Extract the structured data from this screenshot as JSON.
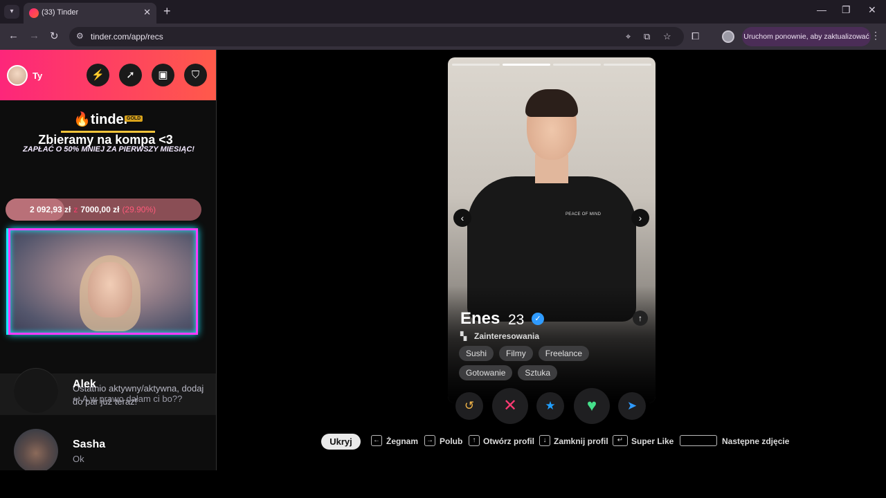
{
  "browser": {
    "tab_title": "(33) Tinder",
    "url": "tinder.com/app/recs",
    "update_label": "Uruchom ponownie, aby zaktualizować"
  },
  "sidebar": {
    "me_label": "Ty",
    "header_buttons": [
      "lightning-icon",
      "explore-icon",
      "briefcase-icon",
      "shield-icon"
    ],
    "promo": {
      "logo": "tinder",
      "badge": "GOLD",
      "title": "Zbieramy na kompa <3",
      "subtitle": "ZAPŁAĆ O 50% MNIEJ ZA PIERWSZY MIESIĄC!",
      "raised": "2 092,93 zł",
      "connector": "z",
      "goal": "7000,00 zł",
      "percent_text": "(29.90%)",
      "progress_fraction": 0.299
    },
    "match_card_text": "Ostatnio aktywny/aktywna, dodaj do par już teraz!",
    "conversations": [
      {
        "name": "Alek",
        "last_message": "↩ A w prawo dałam ci bo??"
      },
      {
        "name": "Sasha",
        "last_message": "Ok"
      }
    ]
  },
  "profile": {
    "name": "Enes",
    "age": "23",
    "interests_label": "Zainteresowania",
    "interests": [
      "Sushi",
      "Filmy",
      "Freelance",
      "Gotowanie",
      "Sztuka"
    ],
    "shirt_text": "PEACE OF MIND",
    "photo_count": 4,
    "current_photo": 2
  },
  "actions": [
    "rewind-icon",
    "nope-icon",
    "super-like-icon",
    "like-icon",
    "boost-icon"
  ],
  "shortcuts": {
    "hide": "Ukryj",
    "nope": "Żegnam",
    "like": "Polub",
    "open": "Otwórz profil",
    "close": "Zamknij profil",
    "super_like": "Super Like",
    "next_photo": "Następne zdjęcie"
  },
  "colors": {
    "brand_gradient_start": "#fd267a",
    "brand_gradient_end": "#ff5a4a",
    "nope": "#fd3a73",
    "super_like": "#21a0ff",
    "like": "#45e08b"
  }
}
